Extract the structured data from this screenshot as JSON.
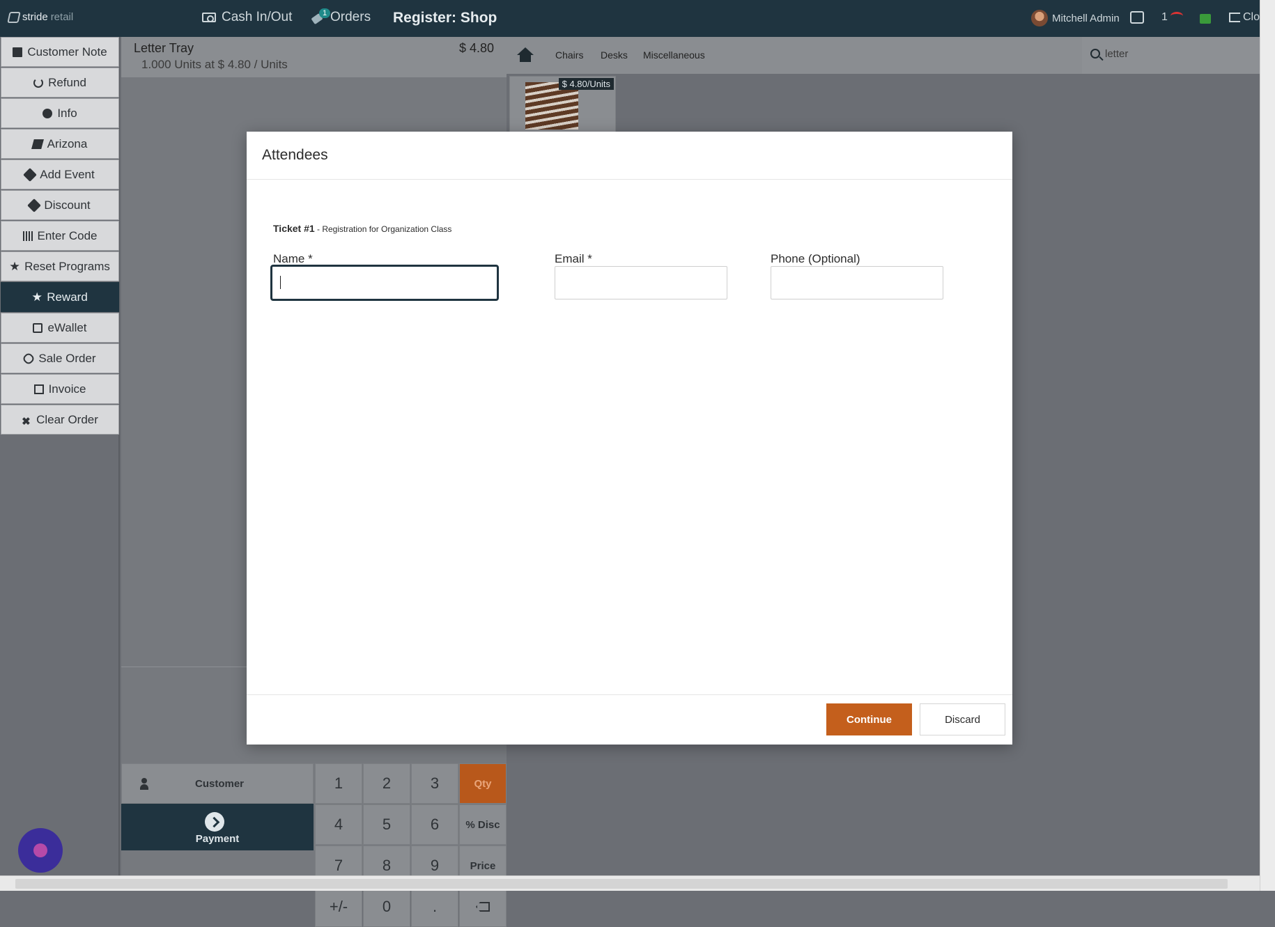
{
  "topbar": {
    "logo_a": "stride",
    "logo_b": "retail",
    "cash": "Cash In/Out",
    "orders": "Orders",
    "orders_badge": "1",
    "register": "Register: Shop",
    "user": "Mitchell Admin",
    "net_count": "1",
    "close": "Clo"
  },
  "actions": [
    {
      "label": "Customer Note",
      "icon": "note-icon"
    },
    {
      "label": "Refund",
      "icon": "undo-icon"
    },
    {
      "label": "Info",
      "icon": "info-icon"
    },
    {
      "label": "Arizona",
      "icon": "book-icon"
    },
    {
      "label": "Add Event",
      "icon": "ticket-icon"
    },
    {
      "label": "Discount",
      "icon": "tag-icon"
    },
    {
      "label": "Enter Code",
      "icon": "barcode-icon"
    },
    {
      "label": "Reset Programs",
      "icon": "star-icon"
    },
    {
      "label": "Reward",
      "icon": "star-icon",
      "active": true
    },
    {
      "label": "eWallet",
      "icon": "credit-card-icon"
    },
    {
      "label": "Sale Order",
      "icon": "link-icon"
    },
    {
      "label": "Invoice",
      "icon": "file-icon"
    },
    {
      "label": "Clear Order",
      "icon": "x-icon"
    }
  ],
  "order": {
    "product": "Letter Tray",
    "qty": "1.000",
    "detail": "Units at $ 4.80 / Units",
    "price": "$ 4.80",
    "customer": "Customer",
    "payment": "Payment"
  },
  "numpad": [
    "1",
    "2",
    "3",
    "Qty",
    "4",
    "5",
    "6",
    "% Disc",
    "7",
    "8",
    "9",
    "Price",
    "+/-",
    "0",
    ".",
    "backspace"
  ],
  "categories": {
    "chairs": "Chairs",
    "desks": "Desks",
    "misc": "Miscellaneous"
  },
  "search": {
    "value": "letter"
  },
  "product_card": {
    "price": "$ 4.80/Units"
  },
  "modal": {
    "title": "Attendees",
    "ticket_no": "Ticket #1",
    "ticket_desc": " - Registration for Organization Class",
    "name_label": "Name *",
    "email_label": "Email *",
    "phone_label": "Phone (Optional)",
    "name_value": "",
    "email_value": "",
    "phone_value": "",
    "continue": "Continue",
    "discard": "Discard"
  },
  "colors": {
    "primary": "#1f3440",
    "accent": "#c45f1c"
  }
}
